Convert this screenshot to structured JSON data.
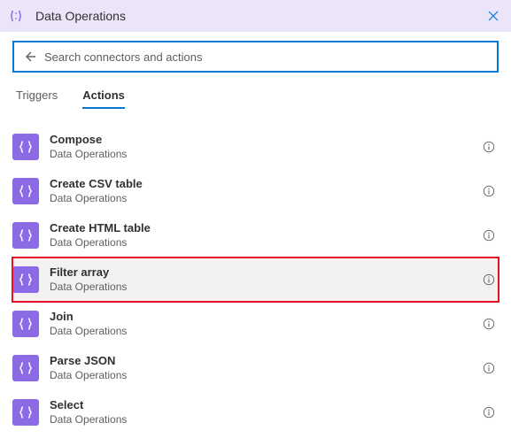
{
  "header": {
    "title": "Data Operations"
  },
  "search": {
    "placeholder": "Search connectors and actions",
    "value": ""
  },
  "tabs": {
    "triggers": "Triggers",
    "actions": "Actions",
    "active": "actions"
  },
  "connector_name": "Data Operations",
  "actions": [
    {
      "name": "Compose",
      "sub": "Data Operations",
      "highlighted": false
    },
    {
      "name": "Create CSV table",
      "sub": "Data Operations",
      "highlighted": false
    },
    {
      "name": "Create HTML table",
      "sub": "Data Operations",
      "highlighted": false
    },
    {
      "name": "Filter array",
      "sub": "Data Operations",
      "highlighted": true
    },
    {
      "name": "Join",
      "sub": "Data Operations",
      "highlighted": false
    },
    {
      "name": "Parse JSON",
      "sub": "Data Operations",
      "highlighted": false
    },
    {
      "name": "Select",
      "sub": "Data Operations",
      "highlighted": false
    }
  ]
}
